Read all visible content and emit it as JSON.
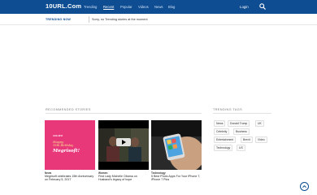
{
  "header": {
    "logo": "10URL.Com",
    "nav": [
      "Trending",
      "Recent",
      "Popular",
      "Videos",
      "News",
      "Blog"
    ],
    "login": "Login",
    "search_icon": "search-icon"
  },
  "trending": {
    "label": "TRENDING NOW",
    "text": "Sorry, no Trending stories at the moment"
  },
  "recommended": {
    "title": "RECOMMENDED STORIES",
    "cards": [
      {
        "image_text_1": "AUG 2017",
        "image_text_2": "Happy",
        "image_text_3": "15th Birthday",
        "image_text_4": "Megrisoft!",
        "category": "News",
        "caption": "Megrisoft celebrates 15th Anniversary on February 5, 2017"
      },
      {
        "category": "Women",
        "caption": "First Lady Michelle Obama on Husband's legacy of hope"
      },
      {
        "category": "Technology",
        "caption": "5 Best Photo Apps For Your iPhone 7, iPhone 7 Plus"
      }
    ]
  },
  "trending_tags": {
    "title": "TRENDING TAGS",
    "tags": [
      "News",
      "Donald Trump",
      "UK",
      "Celebrity",
      "Business",
      "Entertainment",
      "Brexit",
      "Video",
      "Technology",
      "US"
    ]
  },
  "colors": {
    "brand": "#0e4d92",
    "accent_pink": "#e8387a"
  }
}
